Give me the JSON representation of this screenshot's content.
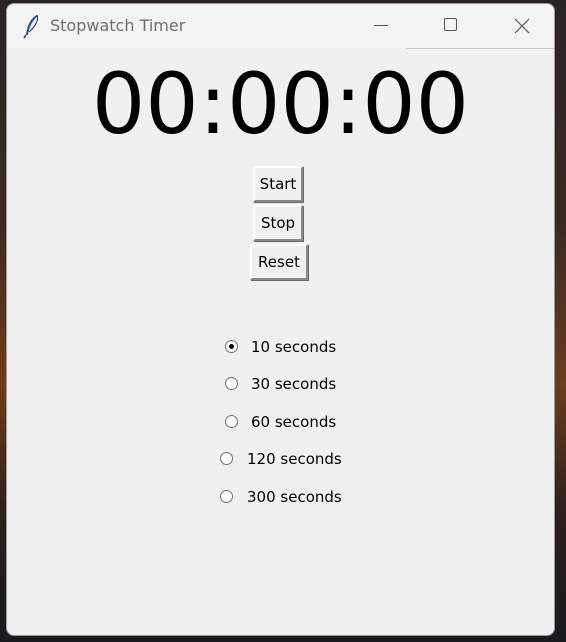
{
  "window": {
    "title": "Stopwatch Timer",
    "icon": "feather-icon"
  },
  "controls": {
    "minimize": "minimize-icon",
    "maximize": "maximize-icon",
    "close": "close-icon"
  },
  "display": {
    "time": "00:00:00"
  },
  "buttons": {
    "start": "Start",
    "stop": "Stop",
    "reset": "Reset"
  },
  "durations": [
    {
      "label": "10 seconds",
      "selected": true
    },
    {
      "label": "30 seconds",
      "selected": false
    },
    {
      "label": "60 seconds",
      "selected": false
    },
    {
      "label": "120 seconds",
      "selected": false
    },
    {
      "label": "300 seconds",
      "selected": false
    }
  ],
  "colors": {
    "window_bg": "#f0f0f0",
    "text": "#000000",
    "title_text": "#6e6e6e"
  }
}
